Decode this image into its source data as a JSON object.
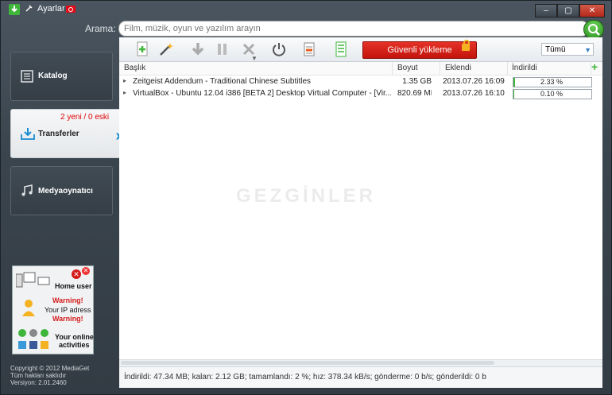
{
  "window": {
    "title": "Ayarlar",
    "minimize": "‒",
    "maximize": "▢",
    "close": "✕"
  },
  "search": {
    "label": "Arama:",
    "placeholder": "Film, müzik, oyun ve yazılım arayın"
  },
  "sidebar": {
    "items": [
      {
        "label": "Katalog"
      },
      {
        "label": "Transferler",
        "count": "2 yeni / 0 eski"
      },
      {
        "label": "Medyaoynatıcı"
      }
    ]
  },
  "toolbar": {
    "safe_label": "Güvenli yükleme",
    "filter_value": "Tümü"
  },
  "table": {
    "headers": [
      "Başlık",
      "Boyut",
      "Eklendi",
      "İndirildi"
    ],
    "rows": [
      {
        "title": "Zeitgeist Addendum - Traditional Chinese Subtitles",
        "size": "1.35 GB",
        "added": "2013.07.26 16:09",
        "progress": "2.33 %",
        "progress_value": 2.33
      },
      {
        "title": "VirtualBox - Ubuntu 12.04 i386 [BETA 2] Desktop Virtual Computer - [Vir...",
        "size": "820.69 MB",
        "added": "2013.07.26 16:10",
        "progress": "0.10 %",
        "progress_value": 0.1
      }
    ]
  },
  "status": "İndirildi: 47.34 MB; kalan: 2.12 GB; tamamlandı: 2 %; hız: 378.34 kB/s; gönderme: 0 b/s; gönderildi: 0 b",
  "watermark": "GEZGİNLER",
  "ad": {
    "home": "Home user",
    "warning1": "Warning!",
    "ip": "Your IP adress",
    "warning2": "Warning!",
    "online1": "Your online",
    "online2": "activities"
  },
  "footer": {
    "copyright": "Copyright © 2012 MediaGet",
    "rights": "Tüm hakları saklıdır",
    "version": "Versiyon: 2.01.2460"
  },
  "colors": {
    "accent": "#3fb63a",
    "danger": "#d41a1a",
    "brand_blue": "#1a8ccf"
  }
}
